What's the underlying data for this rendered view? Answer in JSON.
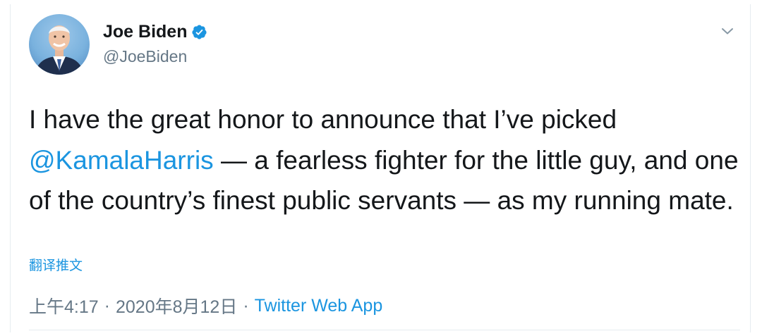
{
  "tweet": {
    "author": {
      "display_name": "Joe Biden",
      "handle": "@JoeBiden",
      "verified": true
    },
    "text_parts": {
      "line1": "I have the great honor to announce that I’ve picked",
      "mention": "@KamalaHarris",
      "rest": " — a fearless fighter for the little guy, and one of the country’s finest public servants — as my running mate."
    },
    "translate_label": "翻译推文",
    "timestamp_time": "上午4:17",
    "separator": "·",
    "timestamp_date": "2020年8月12日",
    "source": "Twitter Web App"
  },
  "colors": {
    "link": "#1b95e0",
    "secondary_text": "#657786",
    "primary_text": "#14171a",
    "border": "#e6ecf0"
  },
  "icons": {
    "verified": "verified-badge-icon",
    "menu": "chevron-down-icon"
  }
}
